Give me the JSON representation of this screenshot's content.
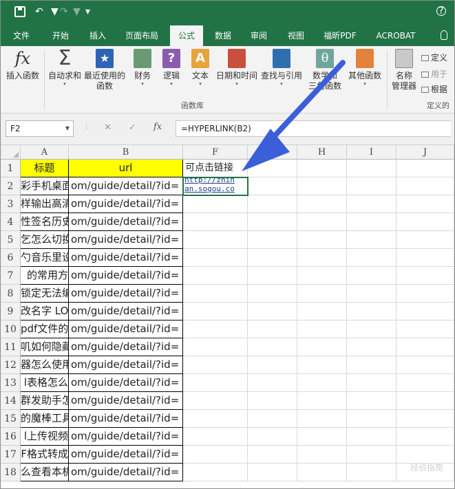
{
  "title_bar": {
    "save_icon": "save-icon",
    "undo_icon": "undo-icon",
    "redo_icon": "redo-icon",
    "customize_icon": "customize-quick-access-icon",
    "help_icon": "help-icon"
  },
  "tabs": [
    "文件",
    "开始",
    "插入",
    "页面布局",
    "公式",
    "数据",
    "审阅",
    "视图",
    "福昕PDF",
    "ACROBAT"
  ],
  "active_tab": "公式",
  "ribbon": {
    "insert_function": "插入函数",
    "autosum": "自动求和",
    "recent_line1": "最近使用的",
    "recent_line2": "函数",
    "financial": "财务",
    "logical": "逻辑",
    "text": "文本",
    "datetime": "日期和时间",
    "lookup": "查找与引用",
    "math_line1": "数学和",
    "math_line2": "三角函数",
    "more": "其他函数",
    "name_manager_line1": "名称",
    "name_manager_line2": "管理器",
    "define_name": "定义",
    "use_in_formula": "用于",
    "create_from_selection": "根据",
    "group_library": "函数库",
    "group_defined_names": "定义的",
    "icons": {
      "insert_function": "fx",
      "autosum": "Σ",
      "logical": "?",
      "text": "A",
      "math": "θ"
    }
  },
  "formula_bar": {
    "name_box": "F2",
    "cancel_symbol": "✕",
    "enter_symbol": "✓",
    "fx_symbol": "fx",
    "formula": "=HYPERLINK(B2)"
  },
  "grid": {
    "columns": [
      "A",
      "B",
      "F",
      "G",
      "H",
      "I",
      "J"
    ],
    "rows": [
      "1",
      "2",
      "3",
      "4",
      "5",
      "6",
      "7",
      "8",
      "9",
      "10",
      "11",
      "12",
      "13",
      "14",
      "15",
      "16",
      "17",
      "18"
    ],
    "header_row": {
      "a": "标题",
      "b": "url",
      "f": "可点击链接"
    },
    "col_a": [
      "彩手机桌面都",
      "样输出高清",
      "性签名历史",
      "乞怎么切换",
      "勺音乐里设",
      "的常用方",
      "锁定无法编",
      "改名字 LOL",
      "pdf文件的",
      "叽如何隐藏",
      "器怎么使用",
      "l表格怎么",
      "群发助手怎",
      "的魔棒工具",
      "l上传视频",
      "F格式转成",
      "么查看本机"
    ],
    "col_b_value": "om/guide/detail/?id=",
    "f2_line1": "http://zhih",
    "f2_line2": "an.sogou.co"
  },
  "watermark": "经验指南"
}
